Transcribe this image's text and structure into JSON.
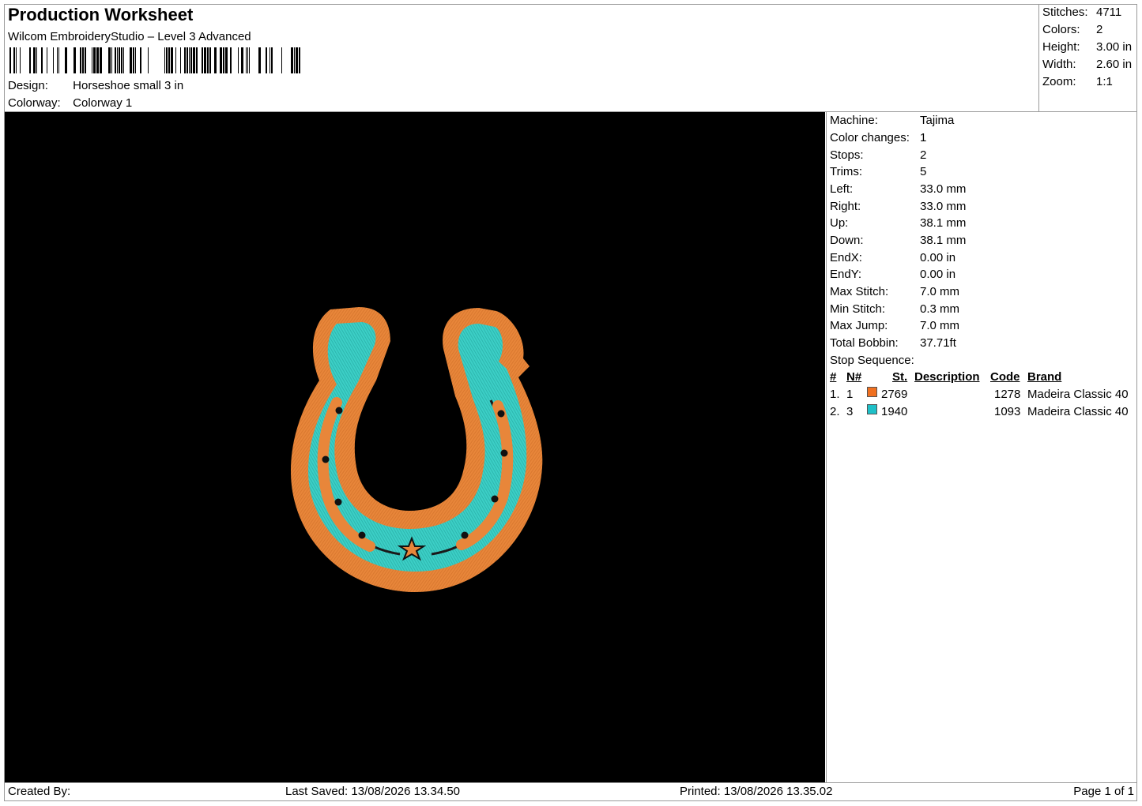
{
  "header": {
    "title": "Production Worksheet",
    "software": "Wilcom EmbroideryStudio – Level 3 Advanced",
    "design_label": "Design:",
    "design_value": "Horseshoe small 3 in",
    "colorway_label": "Colorway:",
    "colorway_value": "Colorway 1"
  },
  "summary": [
    {
      "label": "Stitches:",
      "value": "4711"
    },
    {
      "label": "Colors:",
      "value": "2"
    },
    {
      "label": "Height:",
      "value": "3.00 in"
    },
    {
      "label": "Width:",
      "value": "2.60 in"
    },
    {
      "label": "Zoom:",
      "value": "1:1"
    }
  ],
  "details": [
    {
      "label": "Machine:",
      "value": "Tajima"
    },
    {
      "label": "Color changes:",
      "value": "1"
    },
    {
      "label": "Stops:",
      "value": "2"
    },
    {
      "label": "Trims:",
      "value": "5"
    },
    {
      "label": "Left:",
      "value": "33.0 mm"
    },
    {
      "label": "Right:",
      "value": "33.0 mm"
    },
    {
      "label": "Up:",
      "value": "38.1 mm"
    },
    {
      "label": "Down:",
      "value": "38.1 mm"
    },
    {
      "label": "EndX:",
      "value": "0.00 in"
    },
    {
      "label": "EndY:",
      "value": "0.00 in"
    },
    {
      "label": "Max Stitch:",
      "value": "7.0 mm"
    },
    {
      "label": "Min Stitch:",
      "value": "0.3 mm"
    },
    {
      "label": "Max Jump:",
      "value": "7.0 mm"
    },
    {
      "label": "Total Bobbin:",
      "value": "37.71ft"
    }
  ],
  "stop_sequence": {
    "label": "Stop Sequence:",
    "columns": {
      "num": "#",
      "n": "N#",
      "st": "St.",
      "description": "Description",
      "code": "Code",
      "brand": "Brand"
    },
    "rows": [
      {
        "num": "1.",
        "n": "1",
        "color": "#f07020",
        "st": "2769",
        "description": "",
        "code": "1278",
        "brand": "Madeira Classic 40"
      },
      {
        "num": "2.",
        "n": "3",
        "color": "#1ec0c8",
        "st": "1940",
        "description": "",
        "code": "1093",
        "brand": "Madeira Classic 40"
      }
    ]
  },
  "colors": {
    "background": "#000000",
    "orange": "#e8863a",
    "teal": "#3ccfc6"
  },
  "footer": {
    "created_by": "Created By:",
    "last_saved": "Last Saved: 13/08/2026 13.34.50",
    "printed": "Printed: 13/08/2026 13.35.02",
    "page": "Page 1 of 1"
  }
}
